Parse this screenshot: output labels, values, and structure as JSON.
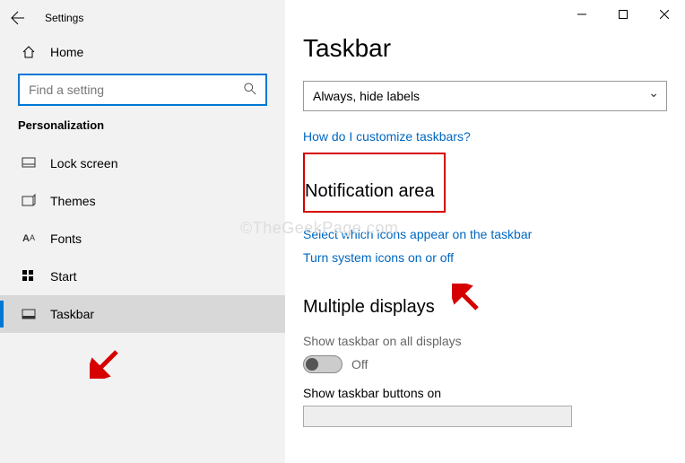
{
  "app_title": "Settings",
  "home_label": "Home",
  "search_placeholder": "Find a setting",
  "category": "Personalization",
  "nav": {
    "lock_screen": "Lock screen",
    "themes": "Themes",
    "fonts": "Fonts",
    "start": "Start",
    "taskbar": "Taskbar"
  },
  "page_title": "Taskbar",
  "behavior_dropdown": "Always, hide labels",
  "link_customize": "How do I customize taskbars?",
  "section_notification": "Notification area",
  "link_select_icons": "Select which icons appear on the taskbar",
  "link_system_icons": "Turn system icons on or off",
  "section_multi": "Multiple displays",
  "show_all_label": "Show taskbar on all displays",
  "toggle_off": "Off",
  "show_buttons_label": "Show taskbar buttons on",
  "watermark": "©TheGeekPage.com"
}
